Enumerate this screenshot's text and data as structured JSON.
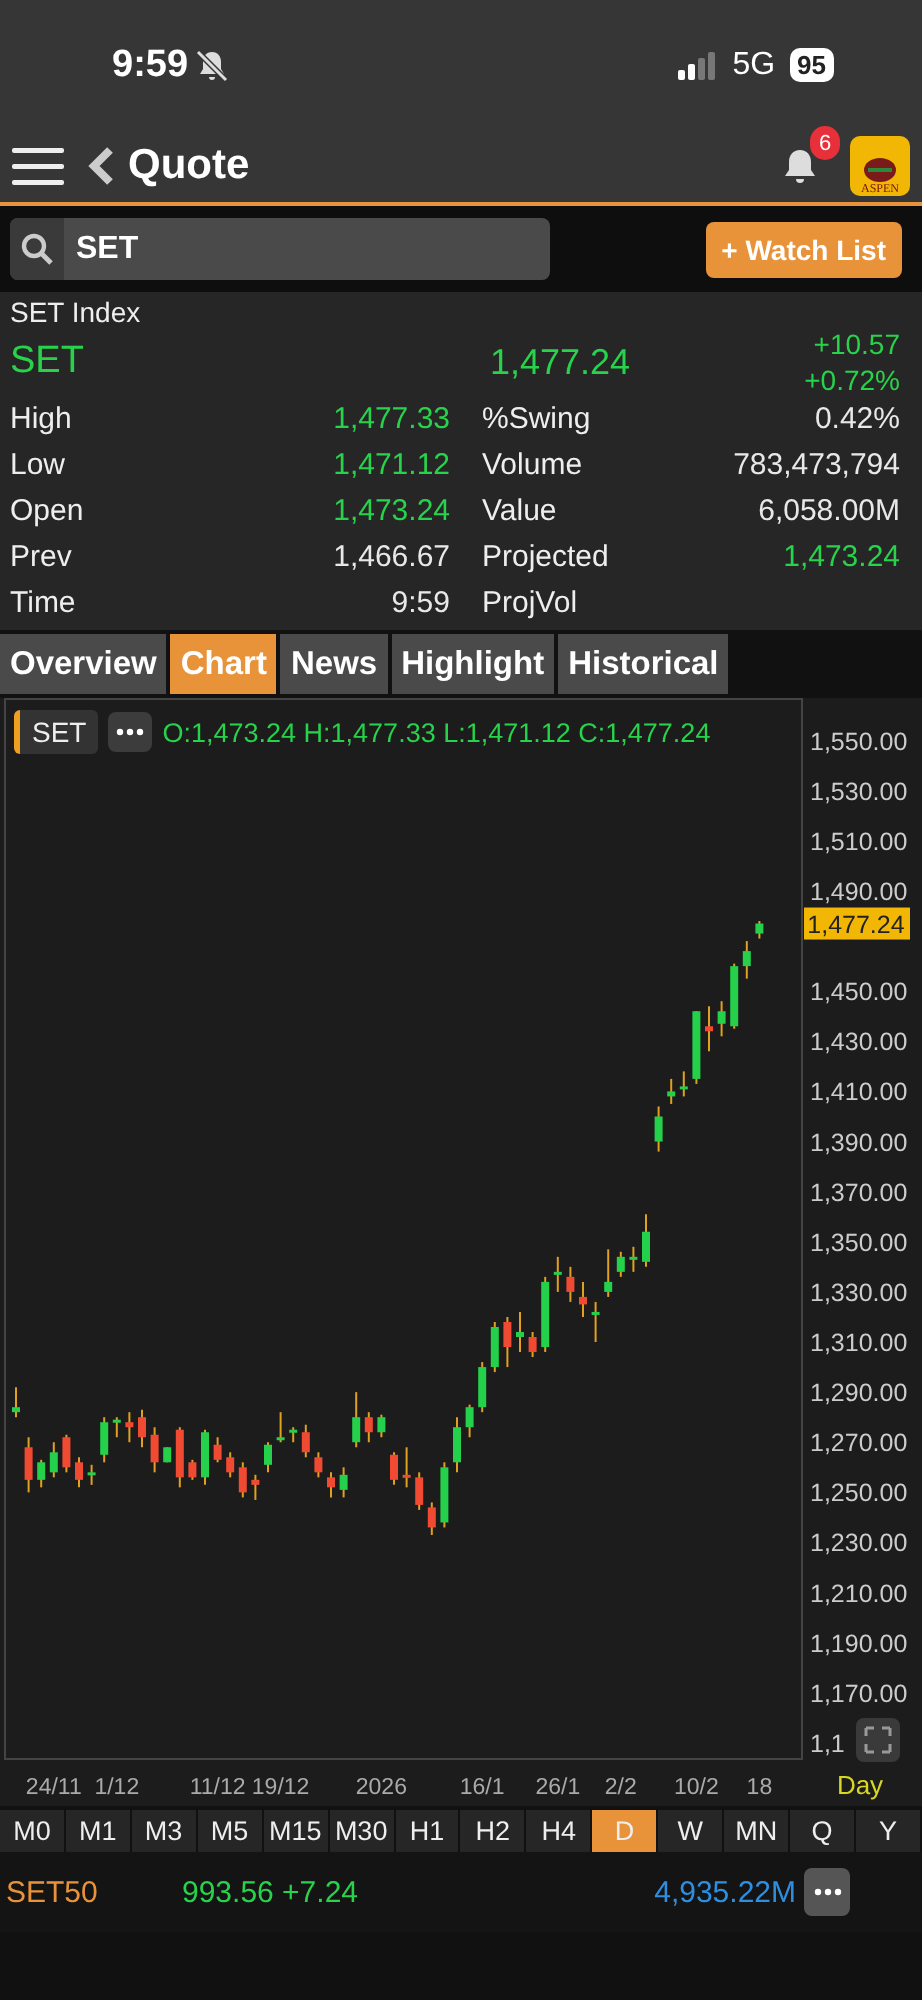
{
  "status_bar": {
    "time": "9:59",
    "muted": true,
    "network": "5G",
    "battery": "95"
  },
  "header": {
    "title": "Quote",
    "notification_count": "6",
    "logo_text": "ASPEN"
  },
  "search": {
    "value": "SET",
    "watch_button": "+ Watch List"
  },
  "quote": {
    "name": "SET Index",
    "symbol": "SET",
    "last": "1,477.24",
    "change": "+10.57",
    "change_pct": "+0.72%",
    "stats": [
      {
        "label": "High",
        "value": "1,477.33",
        "up": true,
        "label2": "%Swing",
        "value2": "0.42%",
        "up2": false
      },
      {
        "label": "Low",
        "value": "1,471.12",
        "up": true,
        "label2": "Volume",
        "value2": "783,473,794",
        "up2": false
      },
      {
        "label": "Open",
        "value": "1,473.24",
        "up": true,
        "label2": "Value",
        "value2": "6,058.00M",
        "up2": false
      },
      {
        "label": "Prev",
        "value": "1,466.67",
        "up": false,
        "label2": "Projected",
        "value2": "1,473.24",
        "up2": true
      },
      {
        "label": "Time",
        "value": "9:59",
        "up": false,
        "label2": "ProjVol"
      }
    ]
  },
  "tabs": [
    {
      "label": "Overview",
      "selected": false
    },
    {
      "label": "Chart",
      "selected": true
    },
    {
      "label": "News",
      "selected": false
    },
    {
      "label": "Highlight",
      "selected": false
    },
    {
      "label": "Historical",
      "selected": false
    }
  ],
  "chart": {
    "symbol": "SET",
    "ohlc": "O:1,473.24 H:1,477.33 L:1,471.12 C:1,477.24",
    "period": "Day",
    "last_price": "1,477.24",
    "y_axis_cut_label": "1,1",
    "chart_data": {
      "type": "candlestick",
      "ylim": [
        1144,
        1567
      ],
      "yticks": [
        {
          "value": 1550,
          "label": "1,550.00"
        },
        {
          "value": 1530,
          "label": "1,530.00"
        },
        {
          "value": 1510,
          "label": "1,510.00"
        },
        {
          "value": 1490,
          "label": "1,490.00"
        },
        {
          "value": 1450,
          "label": "1,450.00"
        },
        {
          "value": 1430,
          "label": "1,430.00"
        },
        {
          "value": 1410,
          "label": "1,410.00"
        },
        {
          "value": 1390,
          "label": "1,390.00"
        },
        {
          "value": 1370,
          "label": "1,370.00"
        },
        {
          "value": 1350,
          "label": "1,350.00"
        },
        {
          "value": 1330,
          "label": "1,330.00"
        },
        {
          "value": 1310,
          "label": "1,310.00"
        },
        {
          "value": 1290,
          "label": "1,290.00"
        },
        {
          "value": 1270,
          "label": "1,270.00"
        },
        {
          "value": 1250,
          "label": "1,250.00"
        },
        {
          "value": 1230,
          "label": "1,230.00"
        },
        {
          "value": 1210,
          "label": "1,210.00"
        },
        {
          "value": 1190,
          "label": "1,190.00"
        },
        {
          "value": 1170,
          "label": "1,170.00"
        }
      ],
      "categories": [
        null,
        null,
        null,
        "24/11",
        null,
        null,
        null,
        null,
        "1/12",
        null,
        null,
        null,
        null,
        null,
        null,
        null,
        "11/12",
        null,
        null,
        null,
        null,
        "19/12",
        null,
        null,
        null,
        null,
        null,
        null,
        null,
        "2026",
        null,
        null,
        null,
        null,
        null,
        null,
        null,
        "16/1",
        null,
        null,
        null,
        null,
        null,
        "26/1",
        null,
        null,
        null,
        null,
        "2/2",
        null,
        null,
        null,
        null,
        null,
        "10/2",
        null,
        null,
        null,
        null,
        "18"
      ],
      "ohlc": [
        [
          1282,
          1292,
          1280,
          1284
        ],
        [
          1268,
          1272,
          1250,
          1255
        ],
        [
          1255,
          1263,
          1252,
          1262
        ],
        [
          1258,
          1270,
          1256,
          1266
        ],
        [
          1272,
          1273,
          1258,
          1260
        ],
        [
          1262,
          1264,
          1252,
          1255
        ],
        [
          1258,
          1261,
          1253,
          1258
        ],
        [
          1265,
          1280,
          1262,
          1278
        ],
        [
          1279,
          1280,
          1272,
          1279
        ],
        [
          1278,
          1282,
          1270,
          1276
        ],
        [
          1280,
          1283,
          1268,
          1272
        ],
        [
          1273,
          1276,
          1258,
          1262
        ],
        [
          1262,
          1268,
          1262,
          1268
        ],
        [
          1275,
          1276,
          1252,
          1256
        ],
        [
          1262,
          1263,
          1255,
          1256
        ],
        [
          1256,
          1275,
          1253,
          1274
        ],
        [
          1269,
          1272,
          1262,
          1263
        ],
        [
          1264,
          1266,
          1256,
          1258
        ],
        [
          1260,
          1262,
          1248,
          1250
        ],
        [
          1255,
          1257,
          1247,
          1253
        ],
        [
          1261,
          1270,
          1258,
          1269
        ],
        [
          1272,
          1282,
          1270,
          1272
        ],
        [
          1275,
          1276,
          1270,
          1275
        ],
        [
          1274,
          1277,
          1264,
          1266
        ],
        [
          1264,
          1266,
          1256,
          1258
        ],
        [
          1256,
          1258,
          1248,
          1252
        ],
        [
          1251,
          1260,
          1248,
          1257
        ],
        [
          1270,
          1290,
          1268,
          1280
        ],
        [
          1280,
          1282,
          1270,
          1274
        ],
        [
          1274,
          1281,
          1272,
          1280
        ],
        [
          1265,
          1266,
          1253,
          1255
        ],
        [
          1257,
          1268,
          1252,
          1256
        ],
        [
          1256,
          1258,
          1243,
          1245
        ],
        [
          1244,
          1246,
          1233,
          1236
        ],
        [
          1238,
          1262,
          1236,
          1260
        ],
        [
          1262,
          1280,
          1258,
          1276
        ],
        [
          1276,
          1285,
          1272,
          1284
        ],
        [
          1284,
          1302,
          1282,
          1300
        ],
        [
          1300,
          1318,
          1298,
          1316
        ],
        [
          1318,
          1320,
          1300,
          1308
        ],
        [
          1312,
          1322,
          1306,
          1314
        ],
        [
          1312,
          1314,
          1304,
          1306
        ],
        [
          1308,
          1336,
          1306,
          1334
        ],
        [
          1338,
          1344,
          1330,
          1338
        ],
        [
          1336,
          1340,
          1326,
          1330
        ],
        [
          1328,
          1334,
          1320,
          1325
        ],
        [
          1322,
          1326,
          1310,
          1322
        ],
        [
          1330,
          1347,
          1328,
          1334
        ],
        [
          1338,
          1346,
          1336,
          1344
        ],
        [
          1344,
          1348,
          1338,
          1344
        ],
        [
          1342,
          1361,
          1340,
          1354
        ],
        [
          1390,
          1404,
          1386,
          1400
        ],
        [
          1408,
          1415,
          1405,
          1410
        ],
        [
          1412,
          1418,
          1408,
          1412
        ],
        [
          1415,
          1442,
          1413,
          1442
        ],
        [
          1436,
          1444,
          1426,
          1434
        ],
        [
          1437,
          1446,
          1432,
          1442
        ],
        [
          1436,
          1461,
          1435,
          1460
        ],
        [
          1460,
          1470,
          1455,
          1466
        ],
        [
          1473,
          1478,
          1471,
          1477
        ]
      ]
    }
  },
  "timeframes": [
    {
      "label": "M0",
      "selected": false
    },
    {
      "label": "M1",
      "selected": false
    },
    {
      "label": "M3",
      "selected": false
    },
    {
      "label": "M5",
      "selected": false
    },
    {
      "label": "M15",
      "selected": false
    },
    {
      "label": "M30",
      "selected": false
    },
    {
      "label": "H1",
      "selected": false
    },
    {
      "label": "H2",
      "selected": false
    },
    {
      "label": "H4",
      "selected": false
    },
    {
      "label": "D",
      "selected": true
    },
    {
      "label": "W",
      "selected": false
    },
    {
      "label": "MN",
      "selected": false
    },
    {
      "label": "Q",
      "selected": false
    },
    {
      "label": "Y",
      "selected": false
    }
  ],
  "ticker": {
    "symbol": "SET50",
    "price": "993.56 +7.24",
    "value": "4,935.22M"
  }
}
